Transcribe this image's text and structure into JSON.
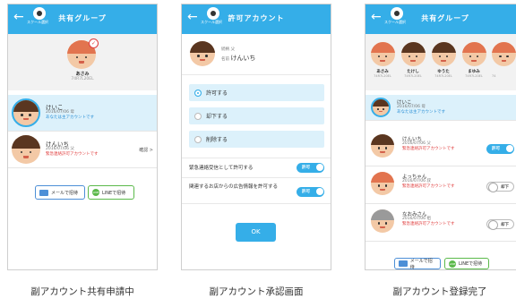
{
  "screens": [
    {
      "title": "共有グループ",
      "school_label": "スクール選択",
      "caption": "副アカウント共有申請中",
      "top_member": {
        "name": "あさみ",
        "id": "74R7L20EL"
      },
      "cards": [
        {
          "name": "けいこ",
          "date": "2016/07/06",
          "role": "母",
          "note": "あなたは主アカウントです"
        },
        {
          "name": "けんいち",
          "date": "2016/07/06",
          "role": "父",
          "note": "緊急連絡許可アカウントです",
          "action": "確認 >"
        }
      ],
      "mail_button": "メールで招待",
      "line_button": "LINEで招待"
    },
    {
      "title": "許可アカウント",
      "school_label": "スクール選択",
      "caption": "副アカウント承認画面",
      "account": {
        "relation_label": "続柄",
        "relation_value": "父",
        "name_label": "名前",
        "name": "けんいち"
      },
      "options": [
        "許可する",
        "却下する",
        "削除する"
      ],
      "toggle_rows": [
        {
          "label": "緊急連絡受信として許可する",
          "state": "許可"
        },
        {
          "label": "関連するお店からの広告情報を許可する",
          "state": "許可"
        }
      ],
      "ok": "OK"
    },
    {
      "title": "共有グループ",
      "school_label": "スクール選択",
      "caption": "副アカウント登録完了",
      "top_members": [
        {
          "name": "あさみ",
          "id": "74R7L20EL"
        },
        {
          "name": "たけし",
          "id": "74R7L20EL"
        },
        {
          "name": "ゆうた",
          "id": "74R7L20EL"
        },
        {
          "name": "まゆみ",
          "id": "74R7L20EL"
        },
        {
          "name": "",
          "id": "74"
        }
      ],
      "cards": [
        {
          "name": "けいこ",
          "date": "2016/07/06",
          "role": "母",
          "note": "あなたは主アカウントです"
        },
        {
          "name": "けんいち",
          "date": "2016/07/06",
          "role": "父",
          "note": "緊急連絡許可アカウントです",
          "toggle": "許可"
        },
        {
          "name": "よっちゃん",
          "date": "2016/07/06",
          "role": "叔",
          "note": "緊急連絡許可アカウントです",
          "toggle": "却下"
        },
        {
          "name": "なおみさん",
          "date": "2016/07/06",
          "role": "祖",
          "note": "緊急連絡許可アカウントです",
          "toggle": "却下"
        }
      ],
      "mail_button": "メールで招待",
      "line_button": "LINEで招待"
    }
  ]
}
